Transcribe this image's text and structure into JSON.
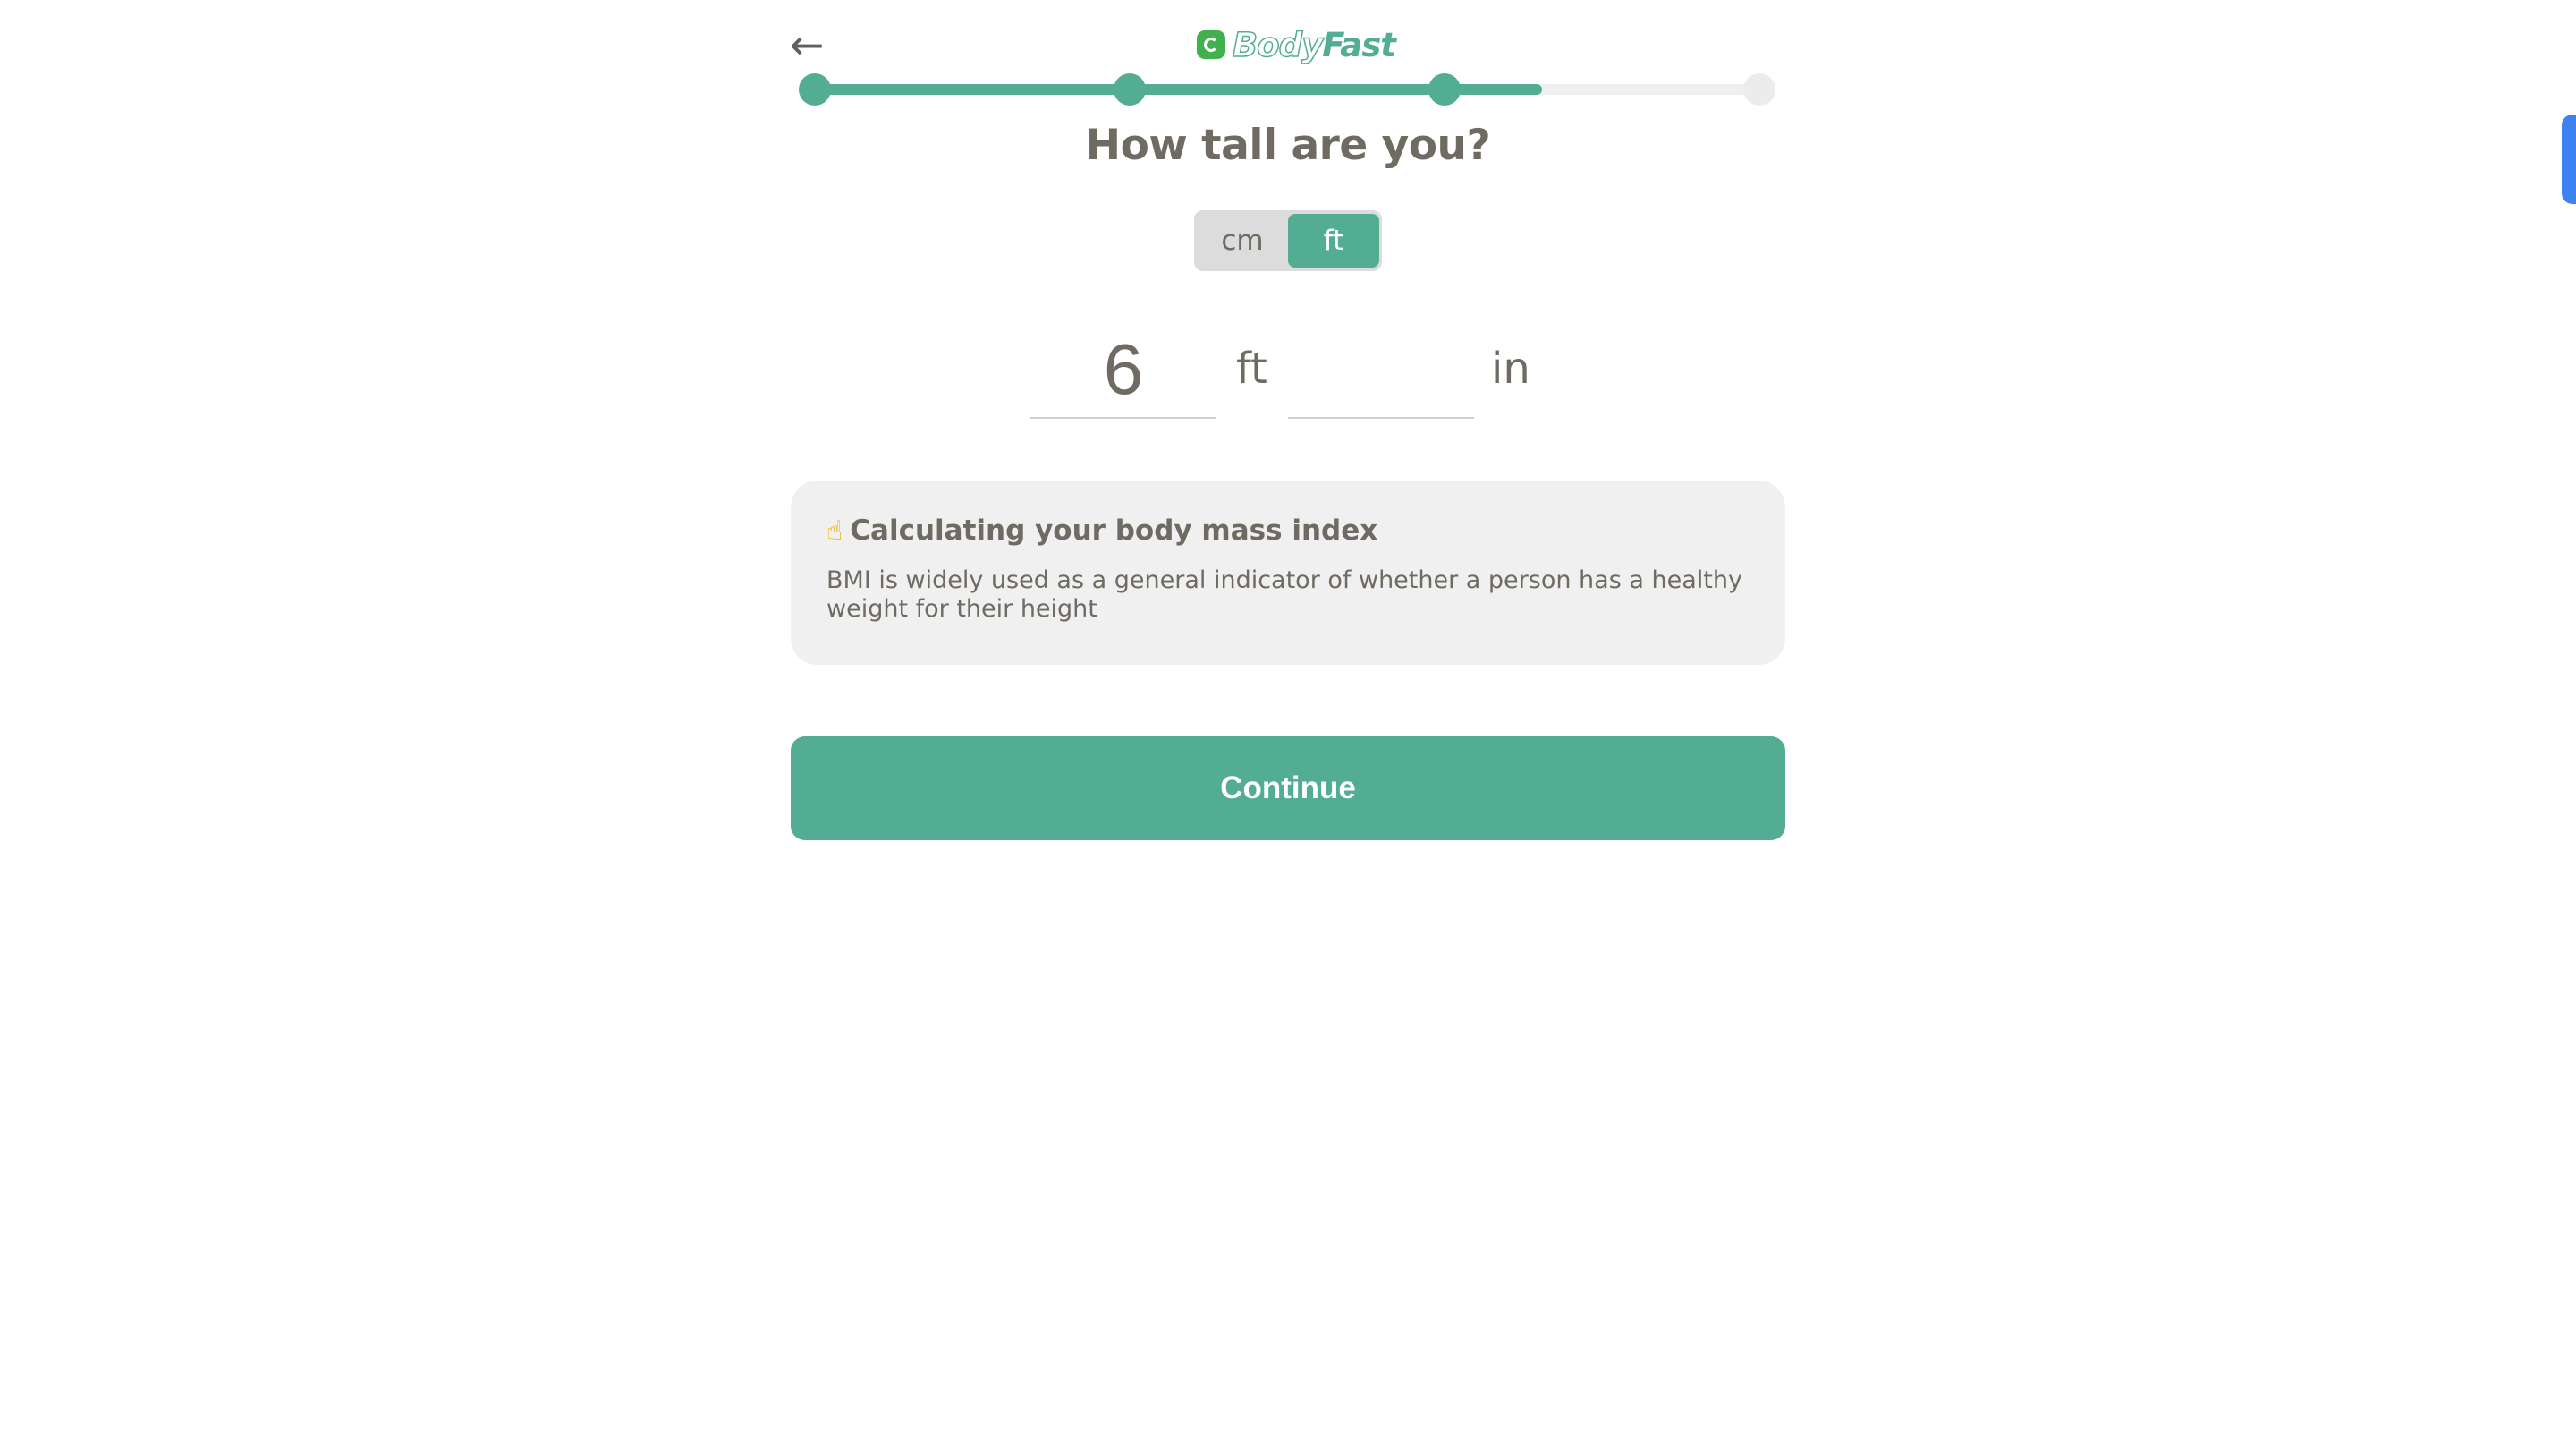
{
  "header": {
    "back_icon": "←",
    "logo": {
      "part1": "Body",
      "part2": "Fast",
      "brand_color": "#52ad93"
    }
  },
  "progress": {
    "fraction": 0.77,
    "steps_completed": 3,
    "steps_total": 4,
    "colors": {
      "done": "#52ad93",
      "todo": "#ececec"
    }
  },
  "question": {
    "title": "How tall are you?"
  },
  "unit_toggle": {
    "options": [
      "cm",
      "ft"
    ],
    "selected": "ft"
  },
  "height": {
    "feet_value": "6",
    "feet_unit": "ft",
    "inches_value": "",
    "inches_unit": "in"
  },
  "info": {
    "icon": "☝",
    "title": "Calculating your body mass index",
    "text": "BMI is widely used as a general indicator of whether a person has a healthy weight for their height"
  },
  "actions": {
    "continue_label": "Continue"
  }
}
